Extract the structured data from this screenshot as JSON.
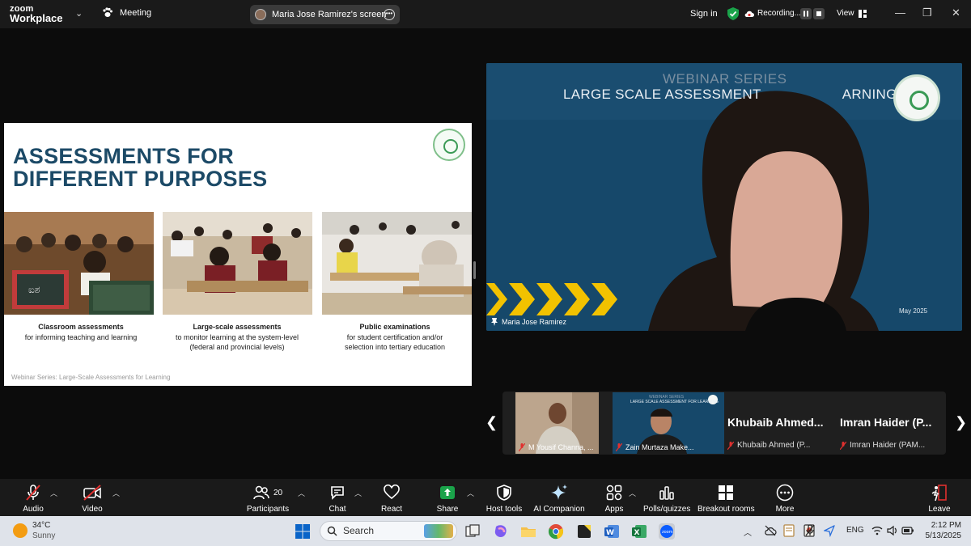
{
  "titlebar": {
    "brand_top": "zoom",
    "brand_bottom": "Workplace",
    "meeting_label": "Meeting",
    "share_label": "Maria Jose Ramirez's screen",
    "sign_in": "Sign in",
    "recording": "Recording...",
    "view": "View"
  },
  "slide": {
    "title_line1": "ASSESSMENTS FOR",
    "title_line2": "DIFFERENT PURPOSES",
    "columns": [
      {
        "heading": "Classroom assessments",
        "line1": "for informing teaching and learning",
        "line2": ""
      },
      {
        "heading": "Large-scale assessments",
        "line1": "to monitor learning at the system-level",
        "line2": "(federal and provincial levels)"
      },
      {
        "heading": "Public examinations",
        "line1": "for student certification and/or",
        "line2": "selection into tertiary education"
      }
    ],
    "footer": "Webinar Series: Large-Scale Assessments for Learning"
  },
  "speaker": {
    "series": "WEBINAR SERIES",
    "title": "LARGE SCALE ASSESSMENT",
    "title_tail": "ARNING",
    "date": "May 2025",
    "name": "Maria Jose Ramirez"
  },
  "gallery": {
    "tiles": [
      {
        "name": "M Yousif Channa, ..."
      },
      {
        "name": "Zain Murtaza Make..."
      }
    ],
    "named": [
      {
        "big": "Khubaib Ahmed...",
        "small": "Khubaib Ahmed (P..."
      },
      {
        "big": "Imran Haider (P...",
        "small": "Imran Haider (PAM..."
      }
    ],
    "tile2_banner": "LARGE SCALE ASSESSMENT FOR LEARNING",
    "tile2_series": "WEBINAR SERIES"
  },
  "toolbar": {
    "audio": "Audio",
    "video": "Video",
    "participants": "Participants",
    "participants_count": "20",
    "chat": "Chat",
    "react": "React",
    "share": "Share",
    "host_tools": "Host tools",
    "ai_companion": "AI Companion",
    "apps": "Apps",
    "polls": "Polls/quizzes",
    "breakout": "Breakout rooms",
    "more": "More",
    "leave": "Leave"
  },
  "taskbar": {
    "temp": "34°C",
    "weather": "Sunny",
    "search_placeholder": "Search",
    "lang": "ENG",
    "time": "2:12 PM",
    "date": "5/13/2025"
  },
  "colors": {
    "slide_title": "#1c4a67",
    "speaker_bg": "#16486a",
    "share_green": "#1aa34a",
    "mic_red": "#e0302f",
    "chevron_yellow": "#f2c200"
  }
}
